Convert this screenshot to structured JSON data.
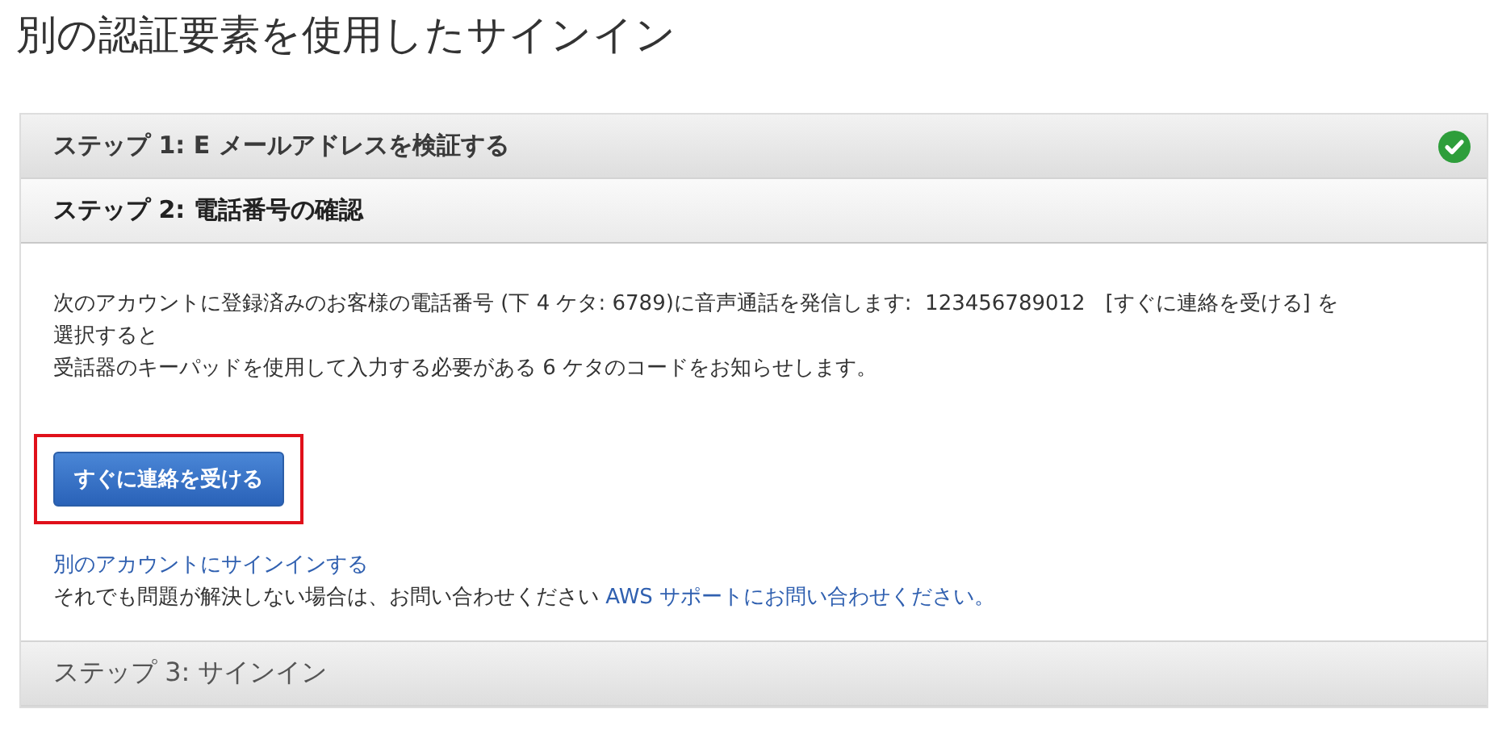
{
  "page_title": "別の認証要素を使用したサインイン",
  "steps": [
    {
      "title": "ステップ 1: E メールアドレスを検証する",
      "completed": true,
      "selected": false
    },
    {
      "title": "ステップ 2: 電話番号の確認",
      "completed": false,
      "selected": true
    },
    {
      "title": "ステップ 3: サインイン",
      "completed": false,
      "selected": false
    }
  ],
  "step_body": {
    "lines": [
      "次のアカウントに登録済みのお客様の電話番号 (下 4 ケタ: 6789)に音声通話を発信します:  123456789012   [すぐに連絡を受ける] を",
      "選択すると",
      "受話器のキーパッドを使用して入力する必要がある 6 ケタのコードをお知らせします。"
    ],
    "button": {
      "label": "すぐに連絡を受ける",
      "highlighted": true
    },
    "other_account_link": "別のアカウントにサインインする",
    "help_text": "それでも問題が解決しない場合は、お問い合わせください",
    "support_link": "AWS サポートにお問い合わせください。"
  }
}
